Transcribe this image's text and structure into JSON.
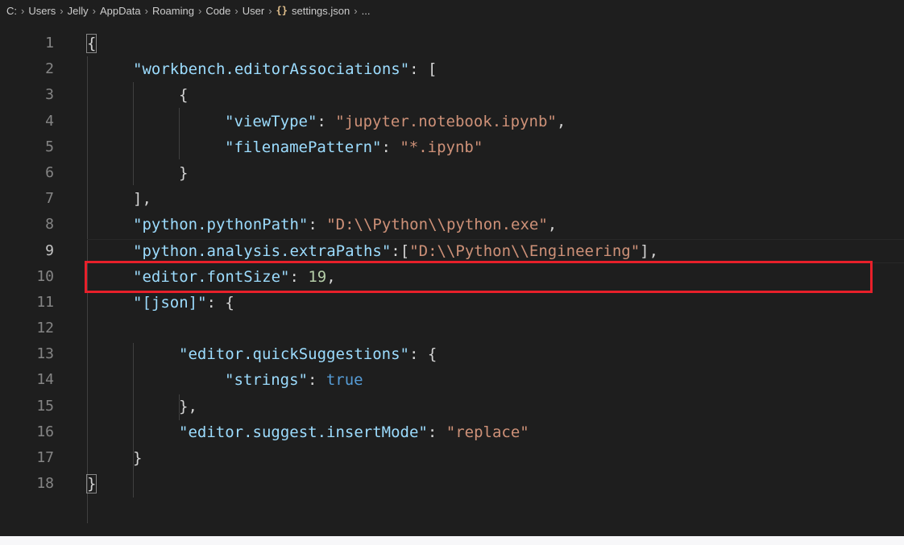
{
  "breadcrumb": {
    "items": [
      "C:",
      "Users",
      "Jelly",
      "AppData",
      "Roaming",
      "Code",
      "User"
    ],
    "file_icon": "{}",
    "file_name": "settings.json",
    "trailing": "..."
  },
  "gutter": {
    "line_numbers": [
      "1",
      "2",
      "3",
      "4",
      "5",
      "6",
      "7",
      "8",
      "9",
      "10",
      "11",
      "12",
      "13",
      "14",
      "15",
      "16",
      "17",
      "18"
    ],
    "active_line": 9
  },
  "code": {
    "l1": "{",
    "l2_key": "\"workbench.editorAssociations\"",
    "l2_rest": ": [",
    "l3": "{",
    "l4_key": "\"viewType\"",
    "l4_colon": ": ",
    "l4_val": "\"jupyter.notebook.ipynb\"",
    "l4_comma": ",",
    "l5_key": "\"filenamePattern\"",
    "l5_colon": ": ",
    "l5_val": "\"*.ipynb\"",
    "l6": "}",
    "l7": "],",
    "l8_key": "\"python.pythonPath\"",
    "l8_colon": ": ",
    "l8_val": "\"D:\\\\Python\\\\python.exe\"",
    "l8_comma": ",",
    "l9_key": "\"python.analysis.extraPaths\"",
    "l9_colon": ":[",
    "l9_val": "\"D:\\\\Python\\\\Engineering\"",
    "l9_end": "],",
    "l10_key": "\"editor.fontSize\"",
    "l10_colon": ": ",
    "l10_val": "19",
    "l10_comma": ",",
    "l11_key": "\"[json]\"",
    "l11_rest": ": {",
    "l12": "",
    "l13_key": "\"editor.quickSuggestions\"",
    "l13_rest": ": {",
    "l14_key": "\"strings\"",
    "l14_colon": ": ",
    "l14_val": "true",
    "l15": "},",
    "l16_key": "\"editor.suggest.insertMode\"",
    "l16_colon": ": ",
    "l16_val": "\"replace\"",
    "l17": "}",
    "l18": "}"
  },
  "colors": {
    "background": "#1e1e1e",
    "key": "#9cdcfe",
    "string": "#ce9178",
    "number": "#b5cea8",
    "boolean": "#569cd6",
    "highlight_box": "#e8202a"
  }
}
